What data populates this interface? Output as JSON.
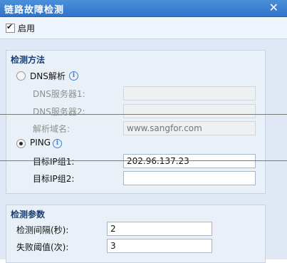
{
  "window": {
    "title": "链路故障检测",
    "close_glyph": "✕"
  },
  "enable": {
    "label": "启用",
    "checked": true
  },
  "method": {
    "legend": "检测方法",
    "dns": {
      "label": "DNS解析",
      "selected": false,
      "server1_label": "DNS服务器1:",
      "server1_value": "",
      "server2_label": "DNS服务器2:",
      "server2_value": "",
      "domain_label": "解析域名:",
      "domain_placeholder": "www.sangfor.com"
    },
    "ping": {
      "label": "PING",
      "selected": true,
      "ip1_label": "目标IP组1:",
      "ip1_value": "202.96.137.23",
      "ip2_label": "目标IP组2:",
      "ip2_value": ""
    }
  },
  "params": {
    "legend": "检测参数",
    "interval_label": "检测间隔(秒):",
    "interval_value": "2",
    "threshold_label": "失败阈值(次):",
    "threshold_value": "3"
  },
  "colors": {
    "titlebar": "#2f74c8",
    "panel": "#eaf0f8",
    "legend": "#1a3f73"
  }
}
